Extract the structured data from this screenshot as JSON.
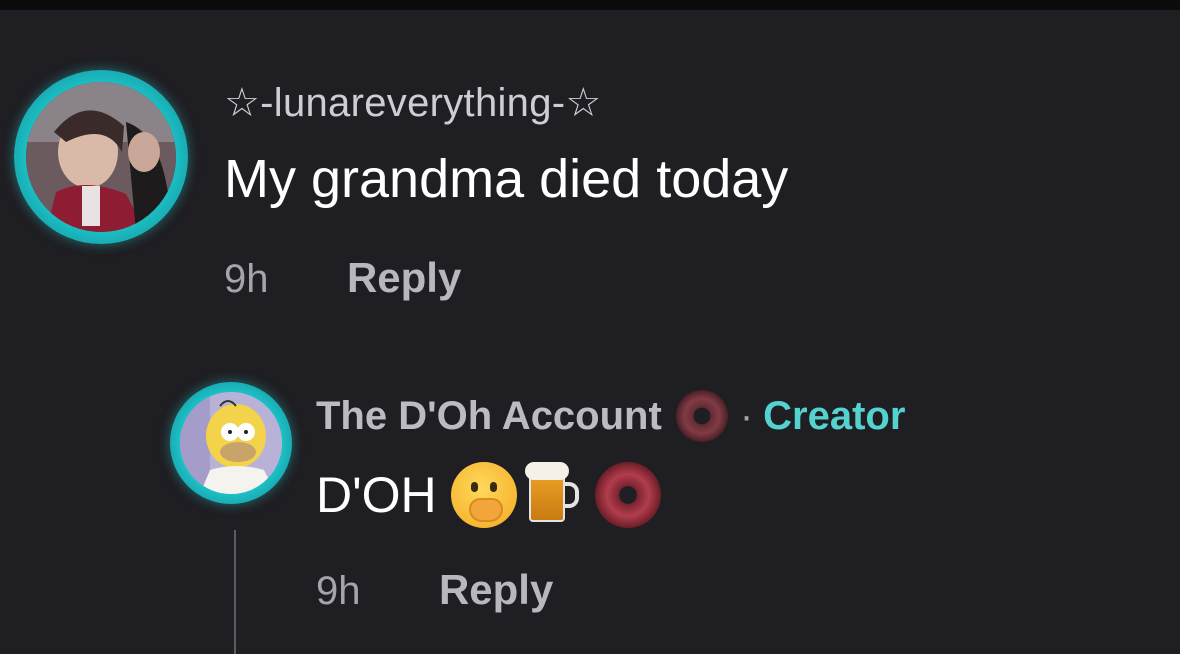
{
  "comments": [
    {
      "username": "☆-lunareverything-☆",
      "text": "My grandma died today",
      "time": "9h",
      "reply_label": "Reply",
      "avatar_icon": "anime-character-avatar"
    }
  ],
  "reply": {
    "username": "The D'Oh Account",
    "badge_icon": "donut-icon",
    "separator": "·",
    "role": "Creator",
    "text": "D'OH",
    "emojis": [
      "face-with-hand-over-mouth-icon",
      "beer-mug-icon",
      "donut-icon"
    ],
    "time": "9h",
    "reply_label": "Reply",
    "avatar_icon": "homer-avatar"
  },
  "colors": {
    "background": "#1f1e22",
    "avatar_ring": "#1bc9cc",
    "creator": "#53d2cf",
    "muted_text": "#a6a4ab"
  }
}
